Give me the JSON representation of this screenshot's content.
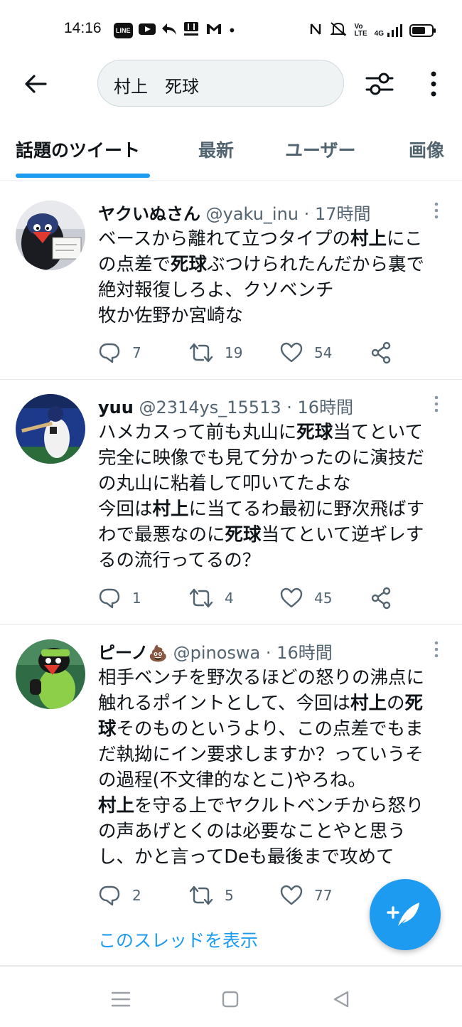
{
  "status_bar": {
    "time": "14:16",
    "app_icons": [
      "LINE",
      "YouTube",
      "Reply",
      "Rakuma",
      "Gmail"
    ],
    "dot": "•",
    "right_icons": [
      "nfc-icon",
      "mute-icon",
      "volte-icon",
      "4g-signal-icon"
    ],
    "volte_label": "Vo\nLTE",
    "network_label": "4G",
    "battery_level": 0.7
  },
  "header": {
    "search_query": "村上　死球"
  },
  "tabs": [
    {
      "label": "話題のツイート",
      "active": true
    },
    {
      "label": "最新",
      "active": false
    },
    {
      "label": "ユーザー",
      "active": false
    },
    {
      "label": "画像",
      "active": false
    }
  ],
  "tweets": [
    {
      "name": "ヤクいぬさん",
      "handle": "@yaku_inu",
      "time": "17時間",
      "body": [
        [
          {
            "t": "ベースから離れて立つタイプの"
          },
          {
            "t": "村上",
            "b": true
          },
          {
            "t": "にこ"
          }
        ],
        [
          {
            "t": "の点差で"
          },
          {
            "t": "死球",
            "b": true
          },
          {
            "t": "ぶつけられたんだから裏で"
          }
        ],
        [
          {
            "t": "絶対報復しろよ、クソベンチ"
          }
        ],
        [
          {
            "t": "牧か佐野か宮崎な"
          }
        ]
      ],
      "replies": "7",
      "retweets": "19",
      "likes": "54"
    },
    {
      "name": "yuu",
      "handle": "@2314ys_15513",
      "time": "16時間",
      "body": [
        [
          {
            "t": "ハメカスって前も丸山に"
          },
          {
            "t": "死球",
            "b": true
          },
          {
            "t": "当てといて"
          }
        ],
        [
          {
            "t": "完全に映像でも見て分かったのに演技だ"
          }
        ],
        [
          {
            "t": "の丸山に粘着して叩いてたよな"
          }
        ],
        [
          {
            "t": "今回は"
          },
          {
            "t": "村上",
            "b": true
          },
          {
            "t": "に当てるわ最初に野次飛ばす"
          }
        ],
        [
          {
            "t": "わで最悪なのに"
          },
          {
            "t": "死球",
            "b": true
          },
          {
            "t": "当てといて逆ギレす"
          }
        ],
        [
          {
            "t": "るの流行ってるの？"
          }
        ]
      ],
      "replies": "1",
      "retweets": "4",
      "likes": "45"
    },
    {
      "name": "ピーノ",
      "name_emoji": "💩",
      "handle": "@pinoswa",
      "time": "16時間",
      "body": [
        [
          {
            "t": "相手ベンチを野次るほどの怒りの沸点に"
          }
        ],
        [
          {
            "t": "触れるポイントとして、今回は"
          },
          {
            "t": "村上",
            "b": true
          },
          {
            "t": "の"
          },
          {
            "t": "死",
            "b": true
          }
        ],
        [
          {
            "t": "球",
            "b": true
          },
          {
            "t": "そのものというより、この点差でもま"
          }
        ],
        [
          {
            "t": "だ執拗にイン要求しますか？っていうそ"
          }
        ],
        [
          {
            "t": "の過程(不文律的なとこ)やろね。"
          }
        ],
        [
          {
            "t": "村上",
            "b": true
          },
          {
            "t": "を守る上でヤクルトベンチから怒り"
          }
        ],
        [
          {
            "t": "の声あげとくのは必要なことやと思う"
          }
        ],
        [
          {
            "t": "し、かと言ってDeも最後まで攻めて"
          }
        ]
      ],
      "replies": "2",
      "retweets": "5",
      "likes": "77",
      "thread_link": "このスレッドを表示"
    }
  ],
  "colors": {
    "accent": "#1d9bf0",
    "text": "#0f1419",
    "secondary": "#536471"
  }
}
